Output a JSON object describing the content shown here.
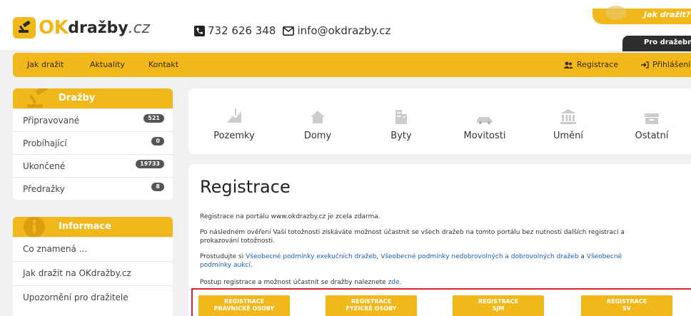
{
  "header": {
    "logo": {
      "ok": "OK",
      "drazby": "dražby",
      "cz": ".cz"
    },
    "phone": "732 626 348",
    "email": "info@okdrazby.cz",
    "hint": "Jak dražit?",
    "drazebnik_label": "Pro dražebníky"
  },
  "nav": {
    "items": [
      {
        "label": "Jak dražit"
      },
      {
        "label": "Aktuality"
      },
      {
        "label": "Kontakt"
      }
    ],
    "registrace": "Registrace",
    "prihlaseni": "Přihlášení"
  },
  "sidebar": {
    "drazby": {
      "title": "Dražby",
      "items": [
        {
          "label": "Připravované",
          "count": "521"
        },
        {
          "label": "Probíhající",
          "count": "0"
        },
        {
          "label": "Ukončené",
          "count": "19733"
        },
        {
          "label": "Předražky",
          "count": "8"
        }
      ]
    },
    "informace": {
      "title": "Informace",
      "items": [
        {
          "label": "Co znamená ..."
        },
        {
          "label": "Jak dražit na OKdražby.cz"
        },
        {
          "label": "Upozornění pro dražitele"
        }
      ]
    }
  },
  "categories": [
    {
      "label": "Pozemky",
      "icon": "land-icon"
    },
    {
      "label": "Domy",
      "icon": "house-icon"
    },
    {
      "label": "Byty",
      "icon": "building-icon"
    },
    {
      "label": "Movitosti",
      "icon": "car-icon"
    },
    {
      "label": "Umění",
      "icon": "museum-icon"
    },
    {
      "label": "Ostatní",
      "icon": "box-icon"
    }
  ],
  "registrace": {
    "title": "Registrace",
    "p1": "Registrace na portálu www.okdrazby.cz je zcela zdarma.",
    "p2a": "Po následném ověření Vaší totožnosti získáváte možnost účastnit se všech dražeb na tomto portálu bez nutnosti dalších registrací a",
    "p2b": "prokazování totožnosti.",
    "p3a": "Prostudujte si ",
    "p3link1": "Všeobecné podmínky exekučních dražeb",
    "p3sep1": ", ",
    "p3link2": "Všeobecné podmínky nedobrovolných a dobrovolných dražeb",
    "p3sep2": " a ",
    "p3link3": "Všeobecné",
    "p3link3b": "podmínky aukcí",
    "p3end": ".",
    "p4a": "Postup registrace a možnost účastnit se dražby naleznete ",
    "p4link": "zde",
    "p4end": ".",
    "buttons": [
      {
        "line1": "REGISTRACE",
        "line2": "PRÁVNICKÉ OSOBY"
      },
      {
        "line1": "REGISTRACE",
        "line2": "FYZICKÉ OSOBY"
      },
      {
        "line1": "REGISTRACE",
        "line2": "SJM"
      },
      {
        "line1": "REGISTRACE",
        "line2": "SV"
      }
    ]
  },
  "colors": {
    "accent": "#f0b81b",
    "badge": "#555555",
    "link": "#1a5fb4",
    "highlight_border": "#d4262c"
  }
}
